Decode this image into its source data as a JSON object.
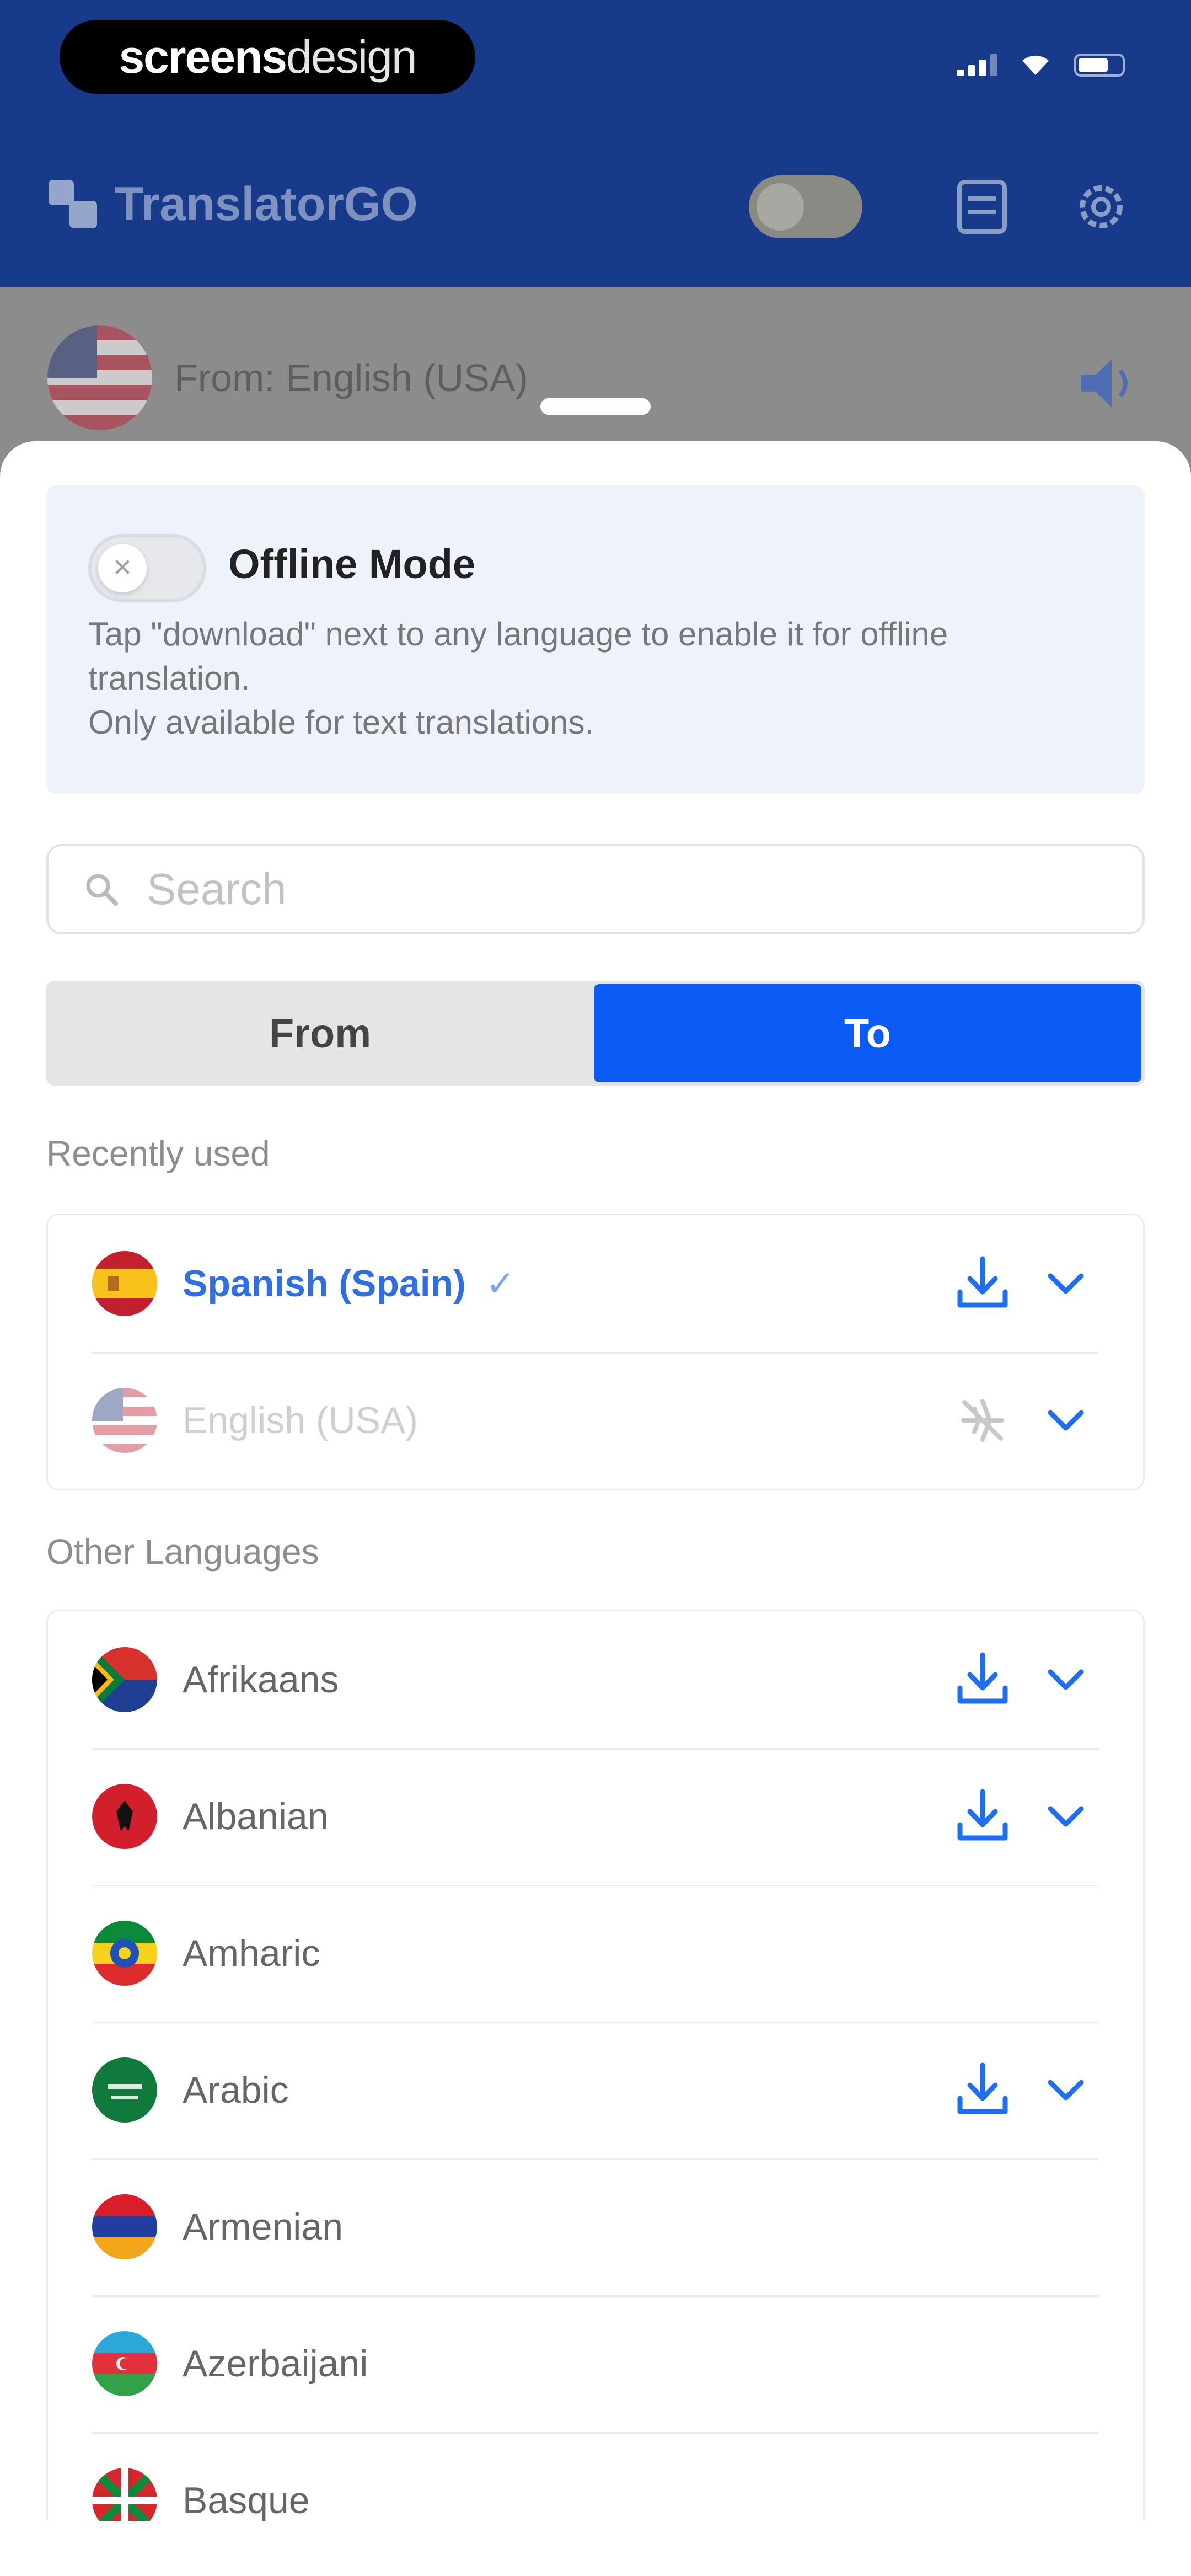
{
  "status_bar": {
    "watermark_bold": "screens",
    "watermark_light": "design"
  },
  "app_bar": {
    "title": "TranslatorGO"
  },
  "underlay": {
    "from_label": "From: English (USA)"
  },
  "offline": {
    "title": "Offline Mode",
    "description": "Tap \"download\" next to any language to enable it for offline translation.\nOnly available for text translations."
  },
  "search": {
    "placeholder": "Search",
    "value": ""
  },
  "tabs": {
    "from_label": "From",
    "to_label": "To",
    "selected": "To"
  },
  "recent": {
    "label": "Recently used",
    "items": [
      {
        "name": "Spanish (Spain)",
        "flag": "spain",
        "selected": true,
        "action": "download-icon"
      },
      {
        "name": "English (USA)",
        "flag": "usa",
        "disabled": true,
        "action": "airplane-off-icon"
      }
    ]
  },
  "other": {
    "label": "Other Languages",
    "items": [
      {
        "name": "Afrikaans",
        "flag": "south-africa",
        "download": true
      },
      {
        "name": "Albanian",
        "flag": "albania",
        "download": true
      },
      {
        "name": "Amharic",
        "flag": "ethiopia",
        "download": false
      },
      {
        "name": "Arabic",
        "flag": "saudi-arabia",
        "download": true
      },
      {
        "name": "Armenian",
        "flag": "armenia",
        "download": false
      },
      {
        "name": "Azerbaijani",
        "flag": "azerbaijan",
        "download": false
      },
      {
        "name": "Basque",
        "flag": "basque",
        "download": false
      }
    ]
  },
  "colors": {
    "accent": "#0b5cf6",
    "header": "#173a8b",
    "selected_text": "#2e6fe6"
  }
}
